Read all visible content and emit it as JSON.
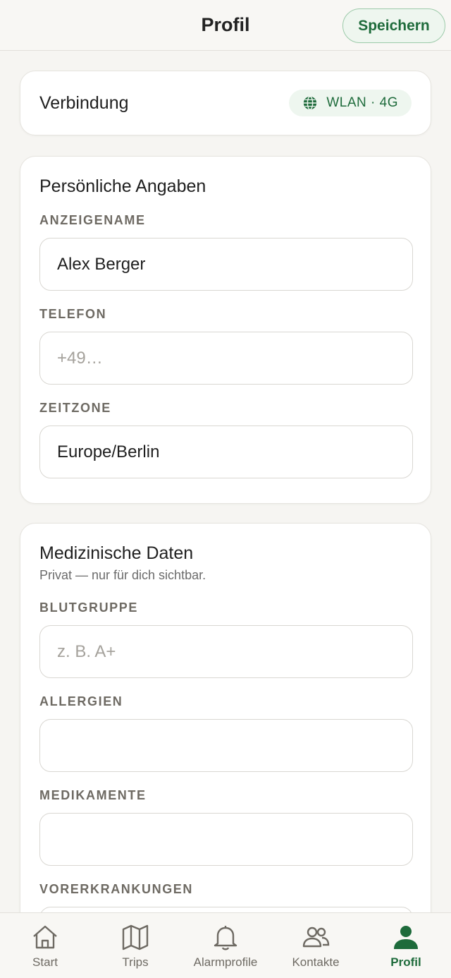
{
  "header": {
    "title": "Profil",
    "save_label": "Speichern"
  },
  "connection": {
    "label": "Verbindung",
    "status": "WLAN · 4G",
    "icon": "globe-icon"
  },
  "personal": {
    "title": "Persönliche Angaben",
    "fields": [
      {
        "label": "ANZEIGENAME",
        "value": "Alex Berger",
        "placeholder": ""
      },
      {
        "label": "TELEFON",
        "value": "",
        "placeholder": "+49…"
      },
      {
        "label": "ZEITZONE",
        "value": "Europe/Berlin",
        "placeholder": ""
      }
    ]
  },
  "medical": {
    "title": "Medizinische Daten",
    "subtitle": "Privat — nur für dich sichtbar.",
    "fields": [
      {
        "label": "BLUTGRUPPE",
        "value": "",
        "placeholder": "z. B. A+"
      },
      {
        "label": "ALLERGIEN",
        "value": "",
        "placeholder": ""
      },
      {
        "label": "MEDIKAMENTE",
        "value": "",
        "placeholder": ""
      },
      {
        "label": "VORERKRANKUNGEN",
        "value": "",
        "placeholder": ""
      }
    ]
  },
  "nav": {
    "items": [
      {
        "label": "Start",
        "icon": "home-icon"
      },
      {
        "label": "Trips",
        "icon": "map-icon"
      },
      {
        "label": "Alarmprofile",
        "icon": "bell-icon"
      },
      {
        "label": "Kontakte",
        "icon": "people-icon"
      },
      {
        "label": "Profil",
        "icon": "person-icon",
        "active": true
      }
    ]
  },
  "colors": {
    "accent": "#1e6b3b",
    "background": "#f6f5f2",
    "card": "#ffffff"
  }
}
